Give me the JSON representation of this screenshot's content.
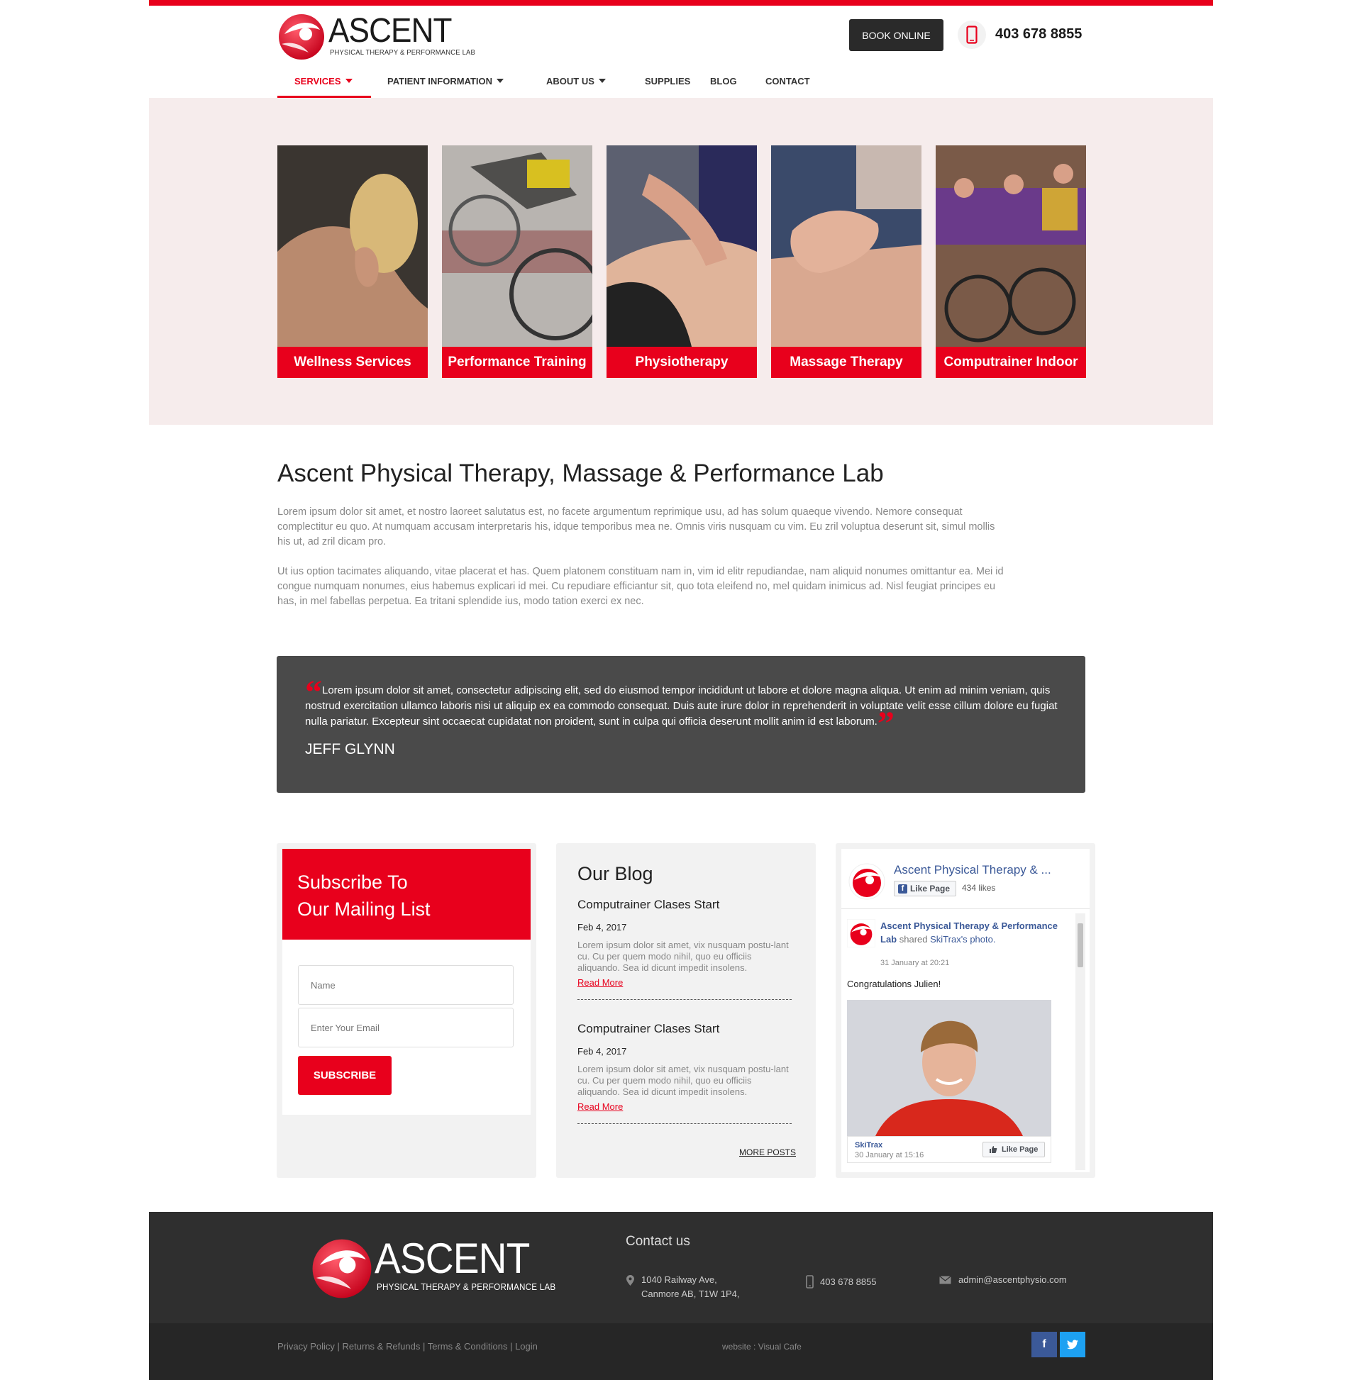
{
  "brand": {
    "name": "ASCENT",
    "tagline": "PHYSICAL THERAPY & PERFORMANCE LAB",
    "accent_color": "#e8001c",
    "dark_color": "#2a2a2a"
  },
  "header": {
    "book_label": "BOOK ONLINE",
    "phone": "403 678 8855",
    "phone_icon": "mobile-phone-icon"
  },
  "nav": {
    "items": [
      {
        "label": "SERVICES",
        "active": true,
        "dropdown": true
      },
      {
        "label": "PATIENT INFORMATION",
        "active": false,
        "dropdown": true
      },
      {
        "label": "ABOUT US",
        "active": false,
        "dropdown": true
      },
      {
        "label": "SUPPLIES",
        "active": false,
        "dropdown": false
      },
      {
        "label": "BLOG",
        "active": false,
        "dropdown": false
      },
      {
        "label": "CONTACT",
        "active": false,
        "dropdown": false
      }
    ]
  },
  "services": [
    {
      "label": "Wellness Services"
    },
    {
      "label": "Performance Training"
    },
    {
      "label": "Physiotherapy"
    },
    {
      "label": "Massage Therapy"
    },
    {
      "label": "Computrainer Indoor"
    }
  ],
  "intro": {
    "title": "Ascent Physical Therapy, Massage & Performance Lab",
    "paragraphs": [
      "Lorem ipsum dolor sit amet, et nostro laoreet salutatus est, no facete argumentum reprimique usu, ad has solum quaeque vivendo. Nemore consequat complectitur eu quo. At numquam accusam interpretaris his, idque temporibus mea ne. Omnis viris nusquam cu vim. Eu zril voluptua deserunt sit, simul mollis his ut, ad zril dicam pro.",
      "Ut ius option tacimates aliquando, vitae placerat et has. Quem platonem constituam nam in, vim id elitr repudiandae, nam aliquid nonumes omittantur ea. Mei id congue numquam nonumes, eius habemus explicari id mei. Cu repudiare efficiantur sit, quo tota eleifend no, mel quidam inimicus ad. Nisl feugiat principes eu has, in mel fabellas perpetua. Ea tritani splendide ius, modo tation exerci ex nec."
    ]
  },
  "testimonial": {
    "text": "Lorem ipsum dolor sit amet, consectetur adipiscing elit, sed do eiusmod tempor incididunt ut labore et dolore magna aliqua. Ut enim ad minim veniam, quis nostrud exercitation ullamco laboris nisi ut aliquip ex ea commodo consequat. Duis aute irure dolor in reprehenderit in voluptate velit esse cillum dolore eu fugiat nulla pariatur. Excepteur sint occaecat cupidatat non proident, sunt in culpa qui officia deserunt mollit anim id est laborum.",
    "author": "JEFF GLYNN",
    "open_quote": "“",
    "close_quote": "”"
  },
  "subscribe": {
    "title_line1": "Subscribe To",
    "title_line2": "Our Mailing List",
    "name_placeholder": "Name",
    "email_placeholder": "Enter Your Email",
    "button_label": "SUBSCRIBE"
  },
  "blog": {
    "title": "Our Blog",
    "posts": [
      {
        "title": "Computrainer Clases Start",
        "date": "Feb 4, 2017",
        "excerpt": "Lorem ipsum dolor sit amet, vix nusquam postu-lant cu. Cu per quem modo nihil, quo eu officiis aliquando. Sea id dicunt impedit insolens.",
        "more": "Read More"
      },
      {
        "title": "Computrainer Clases Start",
        "date": "Feb 4, 2017",
        "excerpt": "Lorem ipsum dolor sit amet, vix nusquam postu-lant cu. Cu per quem modo nihil, quo eu officiis aliquando. Sea id dicunt impedit insolens.",
        "more": "Read More"
      }
    ],
    "more_posts": "MORE POSTS"
  },
  "facebook": {
    "page_name": "Ascent Physical Therapy & ...",
    "like_label": "Like Page",
    "likes": "434 likes",
    "poster": "Ascent Physical Therapy & Performance Lab",
    "action": "shared",
    "shared_from": "SkiTrax's",
    "object": "photo.",
    "time": "31 January at 20:21",
    "message": "Congratulations Julien!",
    "source_name": "SkiTrax",
    "source_time": "30 January at 15:16",
    "source_like": "Like Page"
  },
  "footer": {
    "contact_title": "Contact us",
    "address_line1": "1040 Railway Ave,",
    "address_line2": "Canmore  AB, T1W 1P4,",
    "phone": "403 678 8855",
    "email": "admin@ascentphysio.com",
    "links": [
      "Privacy Policy",
      "Returns & Refunds",
      "Terms & Conditions",
      "Login"
    ],
    "separator": " | ",
    "credit": "website : Visual Cafe",
    "facebook_color": "#3b5998",
    "twitter_color": "#1da1f2"
  }
}
